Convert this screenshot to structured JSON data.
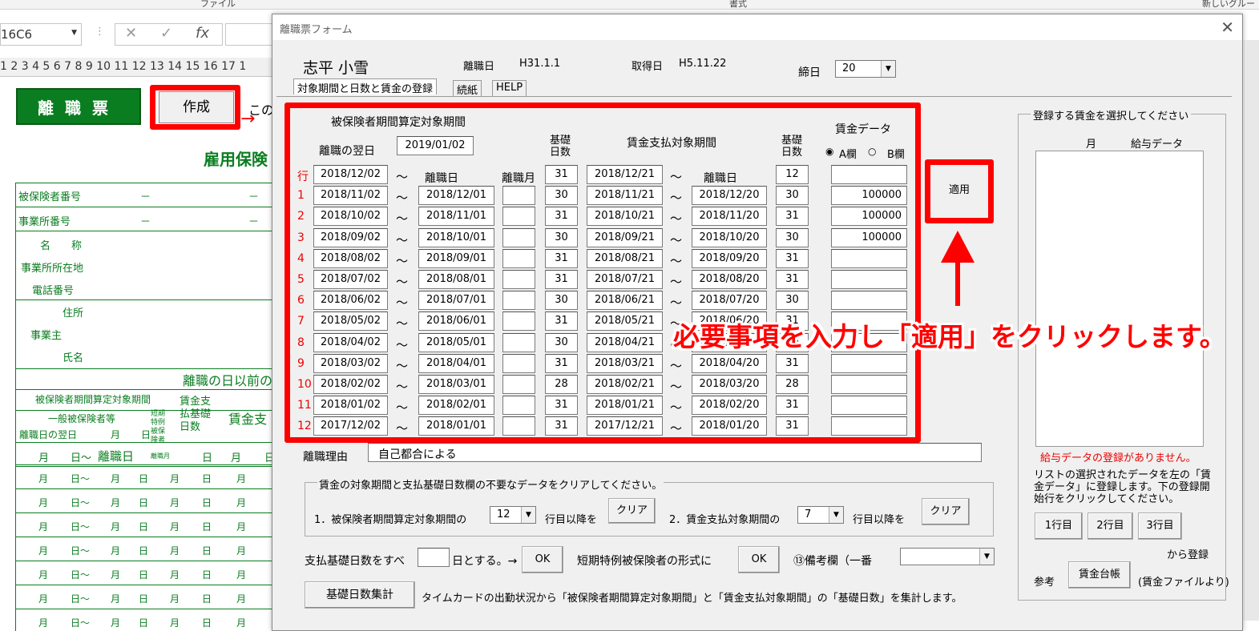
{
  "excel": {
    "ribbon_labels": [
      "ファイル",
      "書式",
      "新しいグルー"
    ],
    "name_box": "16C6",
    "formula_icons": [
      "✕",
      "✓",
      "fx"
    ],
    "column_headers": "1 2 3 4 5 6 7 8 9 10 11 12 13 14 15 16 17 1",
    "green_button": "離職票",
    "create_button": "作成",
    "partial_text": "この",
    "sheet_title": "雇用保険",
    "sheet_labels": [
      "被保険者番号",
      "事業所番号",
      "名　　称",
      "事業所所在地",
      "電話番号",
      "住所",
      "事業主",
      "氏名",
      "離職の日以前の",
      "被保険者期間算定対象期間",
      "一般被保険者等",
      "短期特例被保険者",
      "賃金支払基礎日数",
      "賃金支",
      "離職日の翌日",
      "月",
      "日",
      "離職日",
      "離職月"
    ],
    "dash": "－",
    "row_cells": [
      "月",
      "日～",
      "月",
      "日",
      "月",
      "日",
      "月"
    ]
  },
  "dialog": {
    "title": "離職票フォーム",
    "close": "✕",
    "person_name": "志平 小雪",
    "separation_label": "離職日",
    "separation_value": "H31.1.1",
    "acquired_label": "取得日",
    "acquired_value": "H5.11.22",
    "closing_label": "締日",
    "closing_value": "20",
    "tabs": [
      "対象期間と日数と賃金の登録",
      "続紙",
      "HELP"
    ],
    "section_title": "被保険者期間算定対象期間",
    "next_day_label": "離職の翌日",
    "next_day_value": "2019/01/02",
    "basis_days_header": "基礎\n日数",
    "wage_period_title": "賃金支払対象期間",
    "wage_data_header": "賃金データ",
    "radio_a": "A欄",
    "radio_b": "B欄",
    "col_separation_day": "離職日",
    "col_separation_month": "離職月",
    "col_separation_day2": "離職日",
    "row_label_first": "行",
    "tilde": "～",
    "rows": [
      {
        "n": "行",
        "s1": "2018/12/02",
        "e1": "離職日",
        "m": "",
        "d1": "31",
        "s2": "2018/12/21",
        "e2": "離職日",
        "d2": "12",
        "w": ""
      },
      {
        "n": "1",
        "s1": "2018/11/02",
        "e1": "2018/12/01",
        "m": "",
        "d1": "30",
        "s2": "2018/11/21",
        "e2": "2018/12/20",
        "d2": "30",
        "w": "100000"
      },
      {
        "n": "2",
        "s1": "2018/10/02",
        "e1": "2018/11/01",
        "m": "",
        "d1": "31",
        "s2": "2018/10/21",
        "e2": "2018/11/20",
        "d2": "31",
        "w": "100000"
      },
      {
        "n": "3",
        "s1": "2018/09/02",
        "e1": "2018/10/01",
        "m": "",
        "d1": "30",
        "s2": "2018/09/21",
        "e2": "2018/10/20",
        "d2": "30",
        "w": "100000"
      },
      {
        "n": "4",
        "s1": "2018/08/02",
        "e1": "2018/09/01",
        "m": "",
        "d1": "31",
        "s2": "2018/08/21",
        "e2": "2018/09/20",
        "d2": "31",
        "w": ""
      },
      {
        "n": "5",
        "s1": "2018/07/02",
        "e1": "2018/08/01",
        "m": "",
        "d1": "31",
        "s2": "2018/07/21",
        "e2": "2018/08/20",
        "d2": "31",
        "w": ""
      },
      {
        "n": "6",
        "s1": "2018/06/02",
        "e1": "2018/07/01",
        "m": "",
        "d1": "30",
        "s2": "2018/06/21",
        "e2": "2018/07/20",
        "d2": "30",
        "w": ""
      },
      {
        "n": "7",
        "s1": "2018/05/02",
        "e1": "2018/06/01",
        "m": "",
        "d1": "31",
        "s2": "2018/05/21",
        "e2": "2018/06/20",
        "d2": "31",
        "w": ""
      },
      {
        "n": "8",
        "s1": "2018/04/02",
        "e1": "2018/05/01",
        "m": "",
        "d1": "30",
        "s2": "2018/04/21",
        "e2": "2018/05/20",
        "d2": "30",
        "w": ""
      },
      {
        "n": "9",
        "s1": "2018/03/02",
        "e1": "2018/04/01",
        "m": "",
        "d1": "31",
        "s2": "2018/03/21",
        "e2": "2018/04/20",
        "d2": "31",
        "w": ""
      },
      {
        "n": "10",
        "s1": "2018/02/02",
        "e1": "2018/03/01",
        "m": "",
        "d1": "28",
        "s2": "2018/02/21",
        "e2": "2018/03/20",
        "d2": "28",
        "w": ""
      },
      {
        "n": "11",
        "s1": "2018/01/02",
        "e1": "2018/02/01",
        "m": "",
        "d1": "31",
        "s2": "2018/01/21",
        "e2": "2018/02/20",
        "d2": "31",
        "w": ""
      },
      {
        "n": "12",
        "s1": "2017/12/02",
        "e1": "2018/01/01",
        "m": "",
        "d1": "31",
        "s2": "2017/12/21",
        "e2": "2018/01/20",
        "d2": "31",
        "w": ""
      }
    ],
    "apply_button": "適用",
    "reason_label": "離職理由",
    "reason_value": "自己都合による",
    "clear_group_title": "賃金の対象期間と支払基礎日数欄の不要なデータをクリアしてください。",
    "clear1_label": "1．被保険者期間算定対象期間の",
    "clear1_value": "12",
    "clear1_suffix": "行目以降を",
    "clear_button": "クリア",
    "clear2_label": "2．賃金支払対象期間の",
    "clear2_value": "7",
    "clear2_suffix": "行目以降を",
    "basis_all_label": "支払基礎日数をすべ",
    "basis_all_suffix": "日とする。→",
    "ok_button": "OK",
    "short_term_label": "短期特例被保険者の形式に",
    "remarks_label": "⑬備考欄（一番",
    "count_button": "基礎日数集計",
    "count_desc": "タイムカードの出勤状況から「被保険者期間算定対象期間」と「賃金支払対象期間」の「基礎日数」を集計します。",
    "right_group_title": "登録する賃金を選択してください",
    "list_col_month": "月",
    "list_col_salary": "給与データ",
    "no_data_msg": "給与データの登録がありません。",
    "register_desc": "リストの選択されたデータを左の「賃金データ」に登録します。下の登録開始行をクリックしてください。",
    "row_buttons": [
      "1行目",
      "2行目",
      "3行目"
    ],
    "from_register": "から登録",
    "ref_label": "参考",
    "wage_ledger_button": "賃金台帳",
    "wage_file_note": "(賃金ファイルより)"
  },
  "annotation": "必要事項を入力し「適用」をクリックします。",
  "colors": {
    "highlight": "#ff0000",
    "green": "#0a7d20",
    "row_number": "#e00000"
  }
}
